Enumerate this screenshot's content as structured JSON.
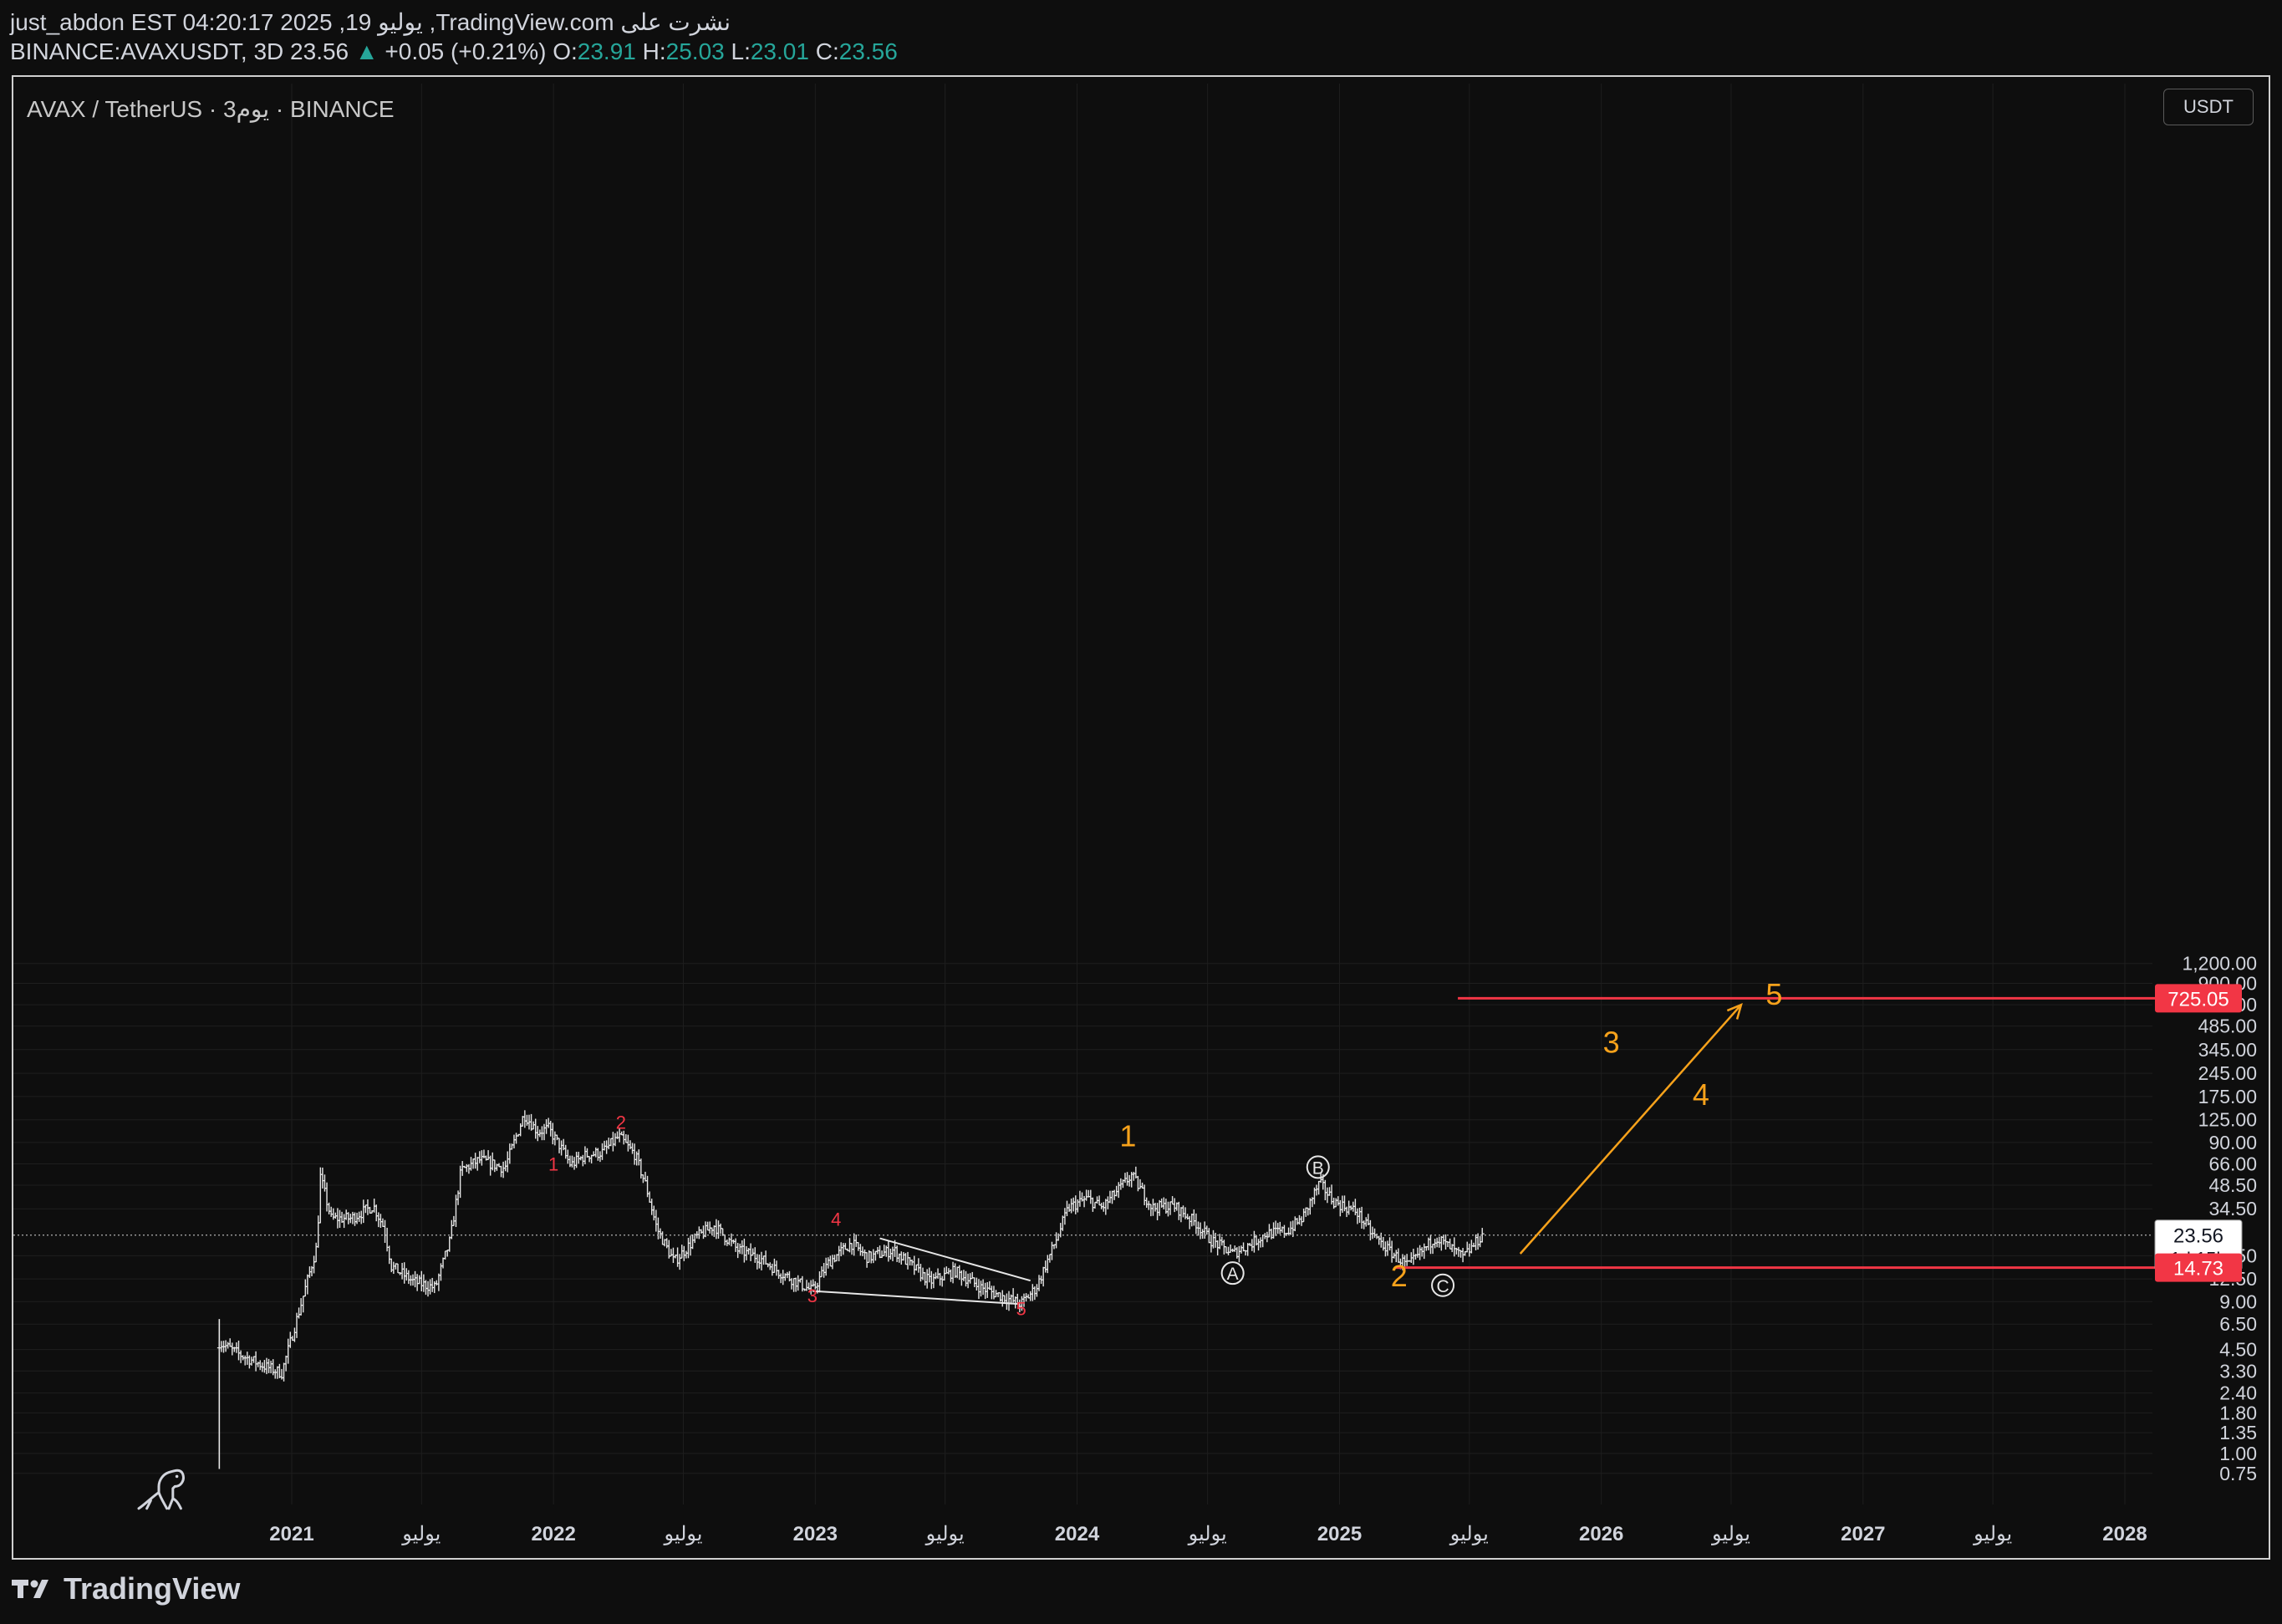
{
  "header": {
    "line1": "just_abdon EST 04:20:17 2025 ,19 يوليو ,TradingView.com نشرت على",
    "symbol": "BINANCE:AVAXUSDT, 3D",
    "last": "23.56",
    "up_arrow": "▲",
    "change": "+0.05 (+0.21%)",
    "open_label": "O:",
    "open": "23.91",
    "high_label": "H:",
    "high": "25.03",
    "low_label": "L:",
    "low": "23.01",
    "close_label": "C:",
    "close": "23.56"
  },
  "chart_title": "AVAX / TetherUS · 3يوم · BINANCE",
  "currency_button": "USDT",
  "footer": {
    "brand": "TradingView",
    "logo_icon": "tradingview-logo-icon"
  },
  "colors": {
    "background": "#0e0e0e",
    "price_bars": "#e6e6e6",
    "wave_orange": "#f7a21b",
    "wave_red": "#f23645",
    "level_red": "#f23645",
    "up_green": "#26a69a"
  },
  "chart_data": {
    "type": "ohlc",
    "scale": "log",
    "ylim": [
      0.75,
      1400
    ],
    "y_ticks": [
      "1,200.00",
      "900.00",
      "660.00",
      "485.00",
      "345.00",
      "245.00",
      "175.00",
      "125.00",
      "90.00",
      "66.00",
      "48.50",
      "34.50",
      "23.56",
      "17.50",
      "12.50",
      "9.00",
      "6.50",
      "4.50",
      "3.30",
      "2.40",
      "1.80",
      "1.35",
      "1.00",
      "0.75"
    ],
    "x_ticks": [
      {
        "date": "2021-01-01",
        "label": "2021"
      },
      {
        "date": "2021-07-01",
        "label": "يوليو"
      },
      {
        "date": "2022-01-01",
        "label": "2022"
      },
      {
        "date": "2022-07-01",
        "label": "يوليو"
      },
      {
        "date": "2023-01-01",
        "label": "2023"
      },
      {
        "date": "2023-07-01",
        "label": "يوليو"
      },
      {
        "date": "2024-01-01",
        "label": "2024"
      },
      {
        "date": "2024-07-01",
        "label": "يوليو"
      },
      {
        "date": "2025-01-01",
        "label": "2025"
      },
      {
        "date": "2025-07-01",
        "label": "يوليو"
      },
      {
        "date": "2026-01-01",
        "label": "2026"
      },
      {
        "date": "2026-07-01",
        "label": "يوليو"
      },
      {
        "date": "2027-01-01",
        "label": "2027"
      },
      {
        "date": "2027-07-01",
        "label": "يوليو"
      },
      {
        "date": "2028-01-01",
        "label": "2028"
      }
    ],
    "price_path": [
      [
        "2020-09-22",
        5.0
      ],
      [
        "2020-10-20",
        4.2
      ],
      [
        "2020-11-20",
        3.6
      ],
      [
        "2020-12-18",
        3.2
      ],
      [
        "2021-01-10",
        7.5
      ],
      [
        "2021-02-05",
        20
      ],
      [
        "2021-02-10",
        55
      ],
      [
        "2021-02-25",
        30
      ],
      [
        "2021-03-25",
        30
      ],
      [
        "2021-04-25",
        36
      ],
      [
        "2021-05-10",
        26
      ],
      [
        "2021-05-20",
        15
      ],
      [
        "2021-06-20",
        12
      ],
      [
        "2021-07-20",
        11
      ],
      [
        "2021-08-10",
        22
      ],
      [
        "2021-08-25",
        60
      ],
      [
        "2021-09-20",
        70
      ],
      [
        "2021-10-25",
        62
      ],
      [
        "2021-11-21",
        135
      ],
      [
        "2021-12-10",
        105
      ],
      [
        "2021-12-25",
        110
      ],
      [
        "2022-01-10",
        85
      ],
      [
        "2022-01-25",
        65
      ],
      [
        "2022-02-15",
        75
      ],
      [
        "2022-03-10",
        78
      ],
      [
        "2022-04-02",
        98
      ],
      [
        "2022-04-25",
        75
      ],
      [
        "2022-05-10",
        48
      ],
      [
        "2022-05-25",
        26
      ],
      [
        "2022-06-18",
        16
      ],
      [
        "2022-07-20",
        23
      ],
      [
        "2022-08-13",
        27
      ],
      [
        "2022-09-15",
        19
      ],
      [
        "2022-10-15",
        17
      ],
      [
        "2022-11-10",
        14
      ],
      [
        "2022-12-28",
        10.5
      ],
      [
        "2023-01-20",
        16
      ],
      [
        "2023-02-20",
        21
      ],
      [
        "2023-03-15",
        17
      ],
      [
        "2023-04-20",
        19
      ],
      [
        "2023-06-10",
        12
      ],
      [
        "2023-07-15",
        14
      ],
      [
        "2023-08-20",
        11
      ],
      [
        "2023-10-15",
        8.7
      ],
      [
        "2023-11-05",
        11
      ],
      [
        "2023-12-01",
        21
      ],
      [
        "2023-12-20",
        35
      ],
      [
        "2024-01-15",
        40
      ],
      [
        "2024-02-05",
        35
      ],
      [
        "2024-03-17",
        56
      ],
      [
        "2024-04-15",
        35
      ],
      [
        "2024-05-15",
        36
      ],
      [
        "2024-06-15",
        28
      ],
      [
        "2024-07-05",
        22
      ],
      [
        "2024-08-05",
        18
      ],
      [
        "2024-09-01",
        21
      ],
      [
        "2024-09-20",
        24
      ],
      [
        "2024-10-20",
        25
      ],
      [
        "2024-11-10",
        30
      ],
      [
        "2024-12-04",
        50
      ],
      [
        "2024-12-25",
        38
      ],
      [
        "2025-01-25",
        33
      ],
      [
        "2025-02-15",
        24
      ],
      [
        "2025-03-10",
        19
      ],
      [
        "2025-04-07",
        15
      ],
      [
        "2025-05-15",
        23
      ],
      [
        "2025-06-22",
        17
      ],
      [
        "2025-07-19",
        23.56
      ]
    ],
    "last_price_line": {
      "price": 23.56,
      "label": "23.56",
      "countdown": "1d 15h"
    },
    "levels": [
      {
        "price": 725.05,
        "label": "725.05",
        "from": "2025-06-15"
      },
      {
        "price": 14.73,
        "label": "14.73",
        "from": "2025-03-20"
      }
    ],
    "red_wave_labels": [
      {
        "text": "1",
        "date": "2022-01-01",
        "price": 60
      },
      {
        "text": "2",
        "date": "2022-04-05",
        "price": 110
      },
      {
        "text": "3",
        "date": "2022-12-28",
        "price": 8.9
      },
      {
        "text": "4",
        "date": "2023-01-30",
        "price": 27
      },
      {
        "text": "5",
        "date": "2023-10-15",
        "price": 7.4
      }
    ],
    "diagonal_lines": [
      {
        "from": [
          "2022-12-28",
          10.5
        ],
        "to": [
          "2023-10-12",
          8.7
        ]
      },
      {
        "from": [
          "2023-04-01",
          22.5
        ],
        "to": [
          "2023-10-28",
          12.2
        ]
      }
    ],
    "orange_wave_labels": [
      {
        "text": "1",
        "date": "2024-03-12",
        "price": 85
      },
      {
        "text": "2",
        "date": "2025-03-25",
        "price": 11.2
      },
      {
        "text": "3",
        "date": "2026-01-15",
        "price": 330
      },
      {
        "text": "4",
        "date": "2026-05-20",
        "price": 155
      },
      {
        "text": "5",
        "date": "2026-08-30",
        "price": 660
      }
    ],
    "circled_labels": [
      {
        "text": "A",
        "date": "2024-08-05",
        "price": 13.6
      },
      {
        "text": "B",
        "date": "2024-12-02",
        "price": 63
      },
      {
        "text": "C",
        "date": "2025-05-25",
        "price": 11.4
      }
    ],
    "projection_arrow": {
      "from": [
        "2025-09-10",
        18.0
      ],
      "to": [
        "2026-07-15",
        660
      ]
    }
  }
}
